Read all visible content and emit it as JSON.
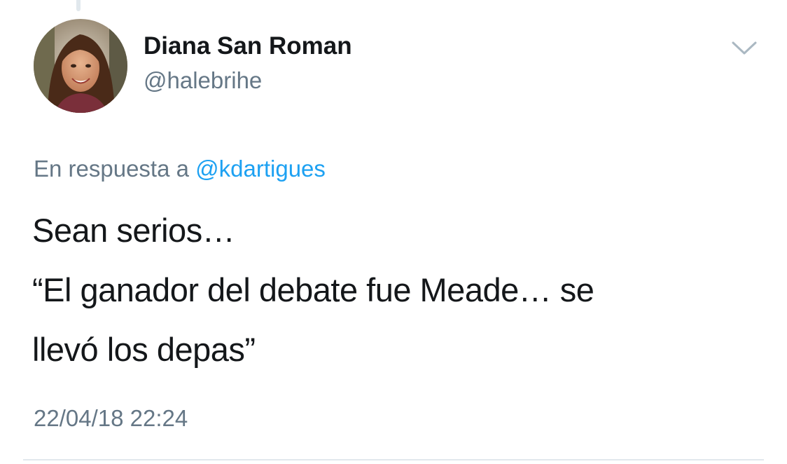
{
  "author": {
    "display_name": "Diana San Roman",
    "handle": "@halebrihe"
  },
  "reply": {
    "prefix": "En respuesta a ",
    "mention": "@kdartigues"
  },
  "tweet": {
    "lines": [
      "Sean serios…",
      "“El ganador del debate fue Meade… se",
      "llevó los depas”"
    ]
  },
  "timestamp": "22/04/18 22:24",
  "icons": {
    "caret": "chevron-down-icon",
    "avatar": "profile-photo"
  },
  "colors": {
    "link": "#1da1f2",
    "secondary_text": "#657786",
    "primary_text": "#14171a",
    "divider": "#e1e8ed"
  }
}
